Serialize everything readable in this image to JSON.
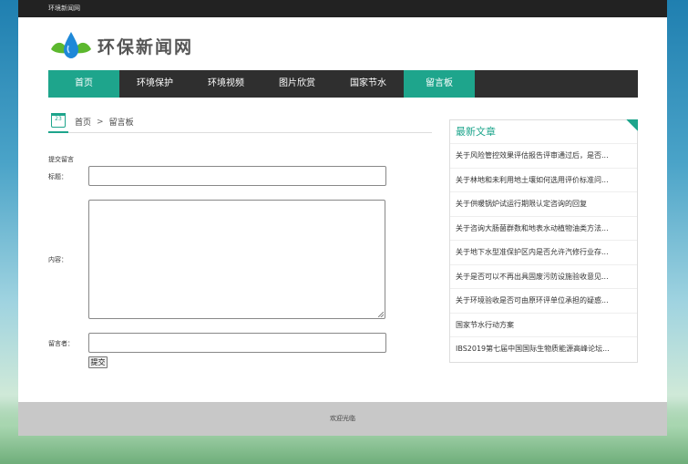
{
  "topbar": {
    "site_name": "环境新闻网"
  },
  "logo": {
    "text": "环保新闻网",
    "icon": "water-drop-leaf-icon"
  },
  "nav": {
    "items": [
      {
        "label": "首页",
        "active": true
      },
      {
        "label": "环境保护",
        "active": false
      },
      {
        "label": "环境视频",
        "active": false
      },
      {
        "label": "图片欣赏",
        "active": false
      },
      {
        "label": "国家节水",
        "active": false
      },
      {
        "label": "留言板",
        "active": true
      }
    ]
  },
  "breadcrumb": {
    "icon_day": "23",
    "home": "首页",
    "separator": ">",
    "current": "留言板"
  },
  "form": {
    "heading": "提交留言",
    "title_label": "标题：",
    "title_value": "",
    "content_label": "内容：",
    "content_value": "",
    "author_label": "留言者：",
    "author_value": "",
    "submit_label": "提交"
  },
  "sidebar": {
    "title": "最新文章",
    "articles": [
      "关于风险管控效果评估报告评审通过后，是否...",
      "关于林地和未利用地土壤如何选用评价标准问...",
      "关于供暖锅炉试运行期限认定咨询的回复",
      "关于咨询大肠菌群数和地表水动植物油类方法...",
      "关于地下水型准保护区内是否允许汽修行业存...",
      "关于是否可以不再出具固废污防设施验收意见...",
      "关于环境验收是否可由原环评单位承担的疑惑...",
      "国家节水行动方案",
      "IBS2019第七届中国国际生物质能源高峰论坛..."
    ]
  },
  "footer": {
    "text": "欢迎光临"
  },
  "colors": {
    "accent": "#1ea58c",
    "nav_bg": "#2f2f2f",
    "topbar_bg": "#222222",
    "footer_bg": "#c8c8c8"
  }
}
